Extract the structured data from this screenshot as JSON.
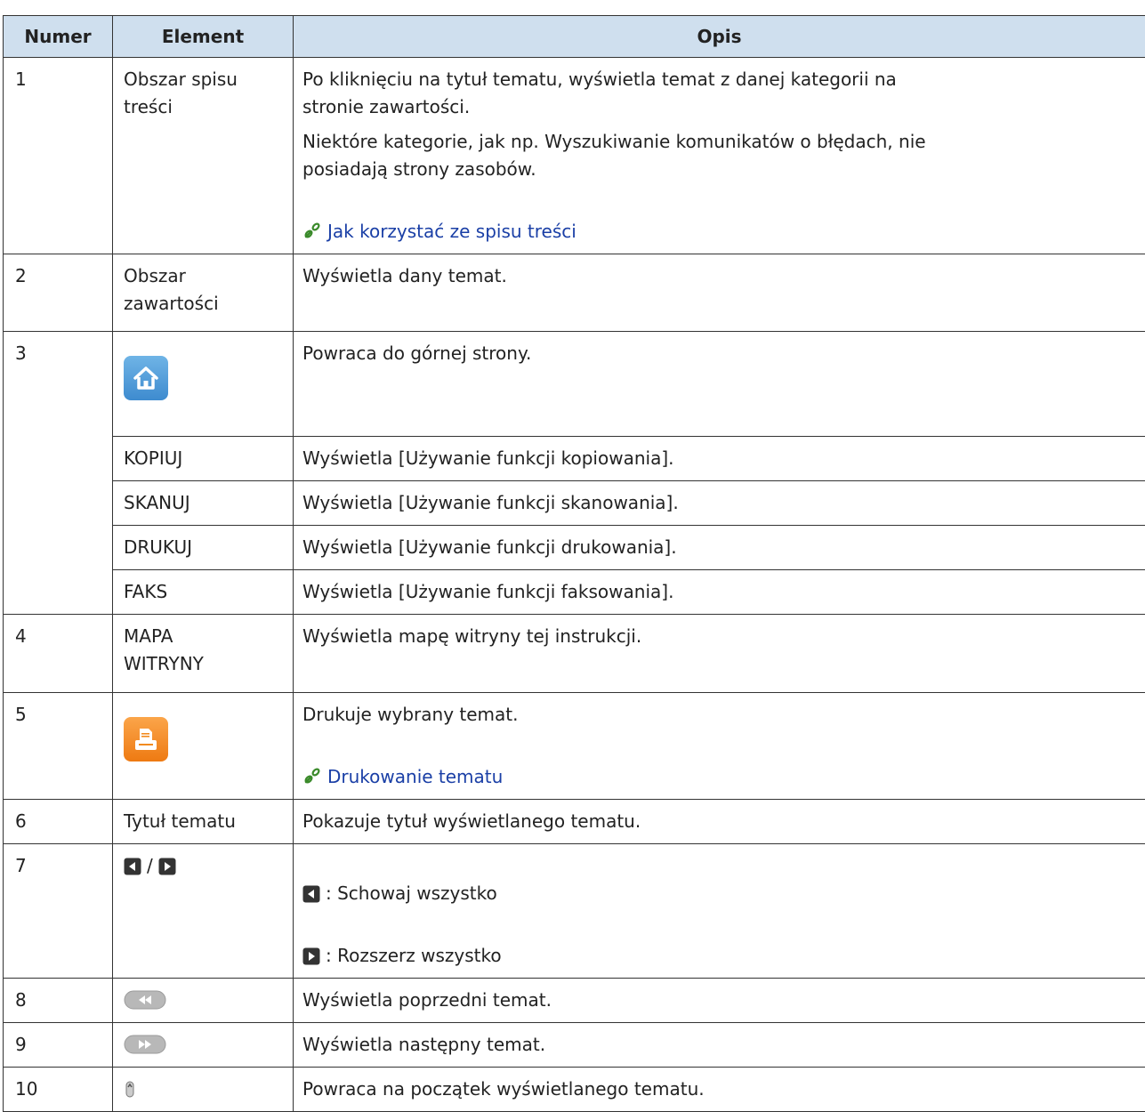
{
  "headers": {
    "numer": "Numer",
    "element": "Element",
    "opis": "Opis"
  },
  "rows": {
    "r1": {
      "num": "1",
      "element": "Obszar spisu\n treści",
      "desc1": "Po kliknięciu na tytuł tematu, wyświetla temat z danej kategorii na\n stronie zawartości.",
      "desc2": "Niektóre kategorie, jak np. Wyszukiwanie komunikatów o błędach, nie\n posiadają strony zasobów.",
      "link": "Jak korzystać ze spisu treści"
    },
    "r2": {
      "num": "2",
      "element": "Obszar\n zawartości",
      "desc": "Wyświetla dany temat."
    },
    "r3": {
      "num": "3",
      "home_icon": "home-icon",
      "home_desc": "Powraca do górnej strony.",
      "kopiuj": "KOPIUJ",
      "kopiuj_desc": "Wyświetla [Używanie funkcji kopiowania].",
      "skanuj": "SKANUJ",
      "skanuj_desc": "Wyświetla [Używanie funkcji skanowania].",
      "drukuj": "DRUKUJ",
      "drukuj_desc": "Wyświetla [Używanie funkcji drukowania].",
      "faks": "FAKS",
      "faks_desc": "Wyświetla [Używanie funkcji faksowania]."
    },
    "r4": {
      "num": "4",
      "element": "MAPA\n WITRYNY",
      "desc": "Wyświetla mapę witryny tej instrukcji."
    },
    "r5": {
      "num": "5",
      "print_icon": "print-icon",
      "desc": "Drukuje wybrany temat.",
      "link": "Drukowanie tematu"
    },
    "r6": {
      "num": "6",
      "element": "Tytuł tematu",
      "desc": "Pokazuje tytuł wyświetlanego tematu."
    },
    "r7": {
      "num": "7",
      "separator": "/",
      "collapse": ": Schowaj wszystko",
      "expand": ": Rozszerz wszystko"
    },
    "r8": {
      "num": "8",
      "desc": "Wyświetla poprzedni temat."
    },
    "r9": {
      "num": "9",
      "desc": "Wyświetla następny temat."
    },
    "r10": {
      "num": "10",
      "desc": "Powraca na początek wyświetlanego tematu."
    }
  },
  "colors": {
    "header_bg": "#cfdfee",
    "link": "#1a3fa6",
    "home_icon": "#4a97d8",
    "print_icon": "#f28a1f"
  }
}
